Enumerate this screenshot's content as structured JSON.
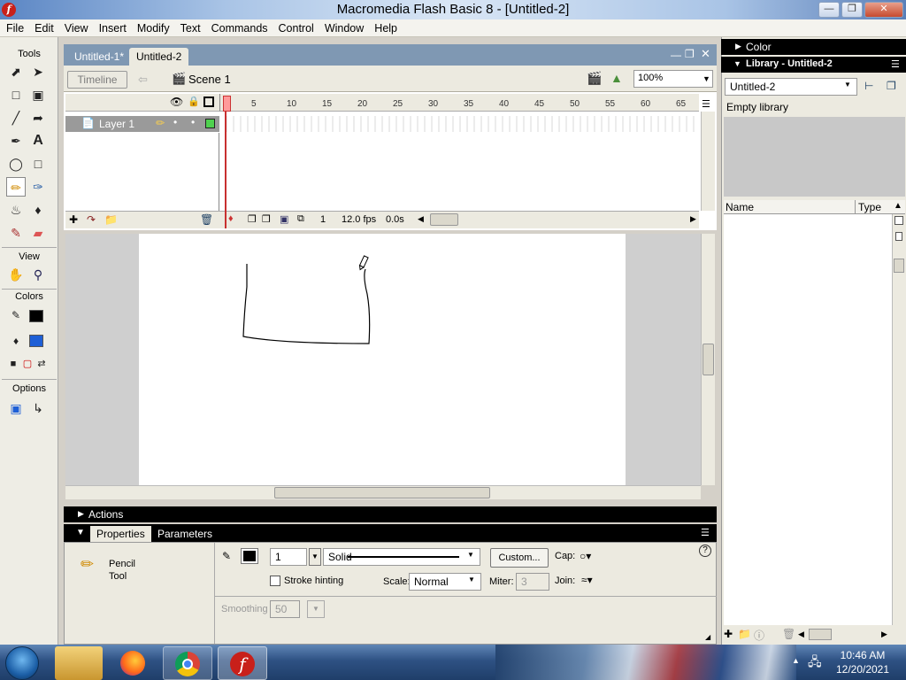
{
  "window": {
    "title": "Macromedia Flash Basic 8 - [Untitled-2]",
    "icon": "flash-icon"
  },
  "menu": [
    "File",
    "Edit",
    "View",
    "Insert",
    "Modify",
    "Text",
    "Commands",
    "Control",
    "Window",
    "Help"
  ],
  "tools": {
    "label": "Tools",
    "view_label": "View",
    "colors_label": "Colors",
    "options_label": "Options",
    "items": [
      "arrow-tool-icon",
      "subselect-tool-icon",
      "free-transform-icon",
      "fill-transform-icon",
      "line-tool-icon",
      "lasso-tool-icon",
      "pen-tool-icon",
      "text-tool-icon",
      "oval-tool-icon",
      "rectangle-tool-icon",
      "pencil-tool-icon",
      "brush-tool-icon",
      "ink-bottle-icon",
      "paint-bucket-icon",
      "eyedropper-icon",
      "eraser-icon",
      "hand-tool-icon",
      "zoom-tool-icon"
    ],
    "stroke_color": "#000000",
    "fill_color": "#1e5fd6"
  },
  "doc": {
    "tabs": [
      "Untitled-1*",
      "Untitled-2"
    ],
    "timeline_button": "Timeline",
    "scene": "Scene 1",
    "zoom": "100%"
  },
  "timeline": {
    "layer_name": "Layer 1",
    "ruler": [
      "1",
      "5",
      "10",
      "15",
      "20",
      "25",
      "30",
      "35",
      "40",
      "45",
      "50",
      "55",
      "60",
      "65"
    ],
    "current_frame": "1",
    "fps": "12.0 fps",
    "elapsed": "0.0s"
  },
  "panels": {
    "actions": "Actions",
    "properties_tab": "Properties",
    "parameters_tab": "Parameters"
  },
  "properties": {
    "tool_name": "Pencil",
    "tool_sub": "Tool",
    "stroke_height": "1",
    "stroke_style": "Solid",
    "custom_button": "Custom...",
    "cap_label": "Cap:",
    "stroke_hinting": "Stroke hinting",
    "scale_label": "Scale:",
    "scale_value": "Normal",
    "miter_label": "Miter:",
    "miter_value": "3",
    "join_label": "Join:",
    "smoothing_label": "Smoothing",
    "smoothing_value": "50"
  },
  "right": {
    "color_panel": "Color",
    "library_panel": "Library - Untitled-2",
    "library_doc": "Untitled-2",
    "library_status": "Empty library",
    "col_name": "Name",
    "col_type": "Type"
  },
  "taskbar": {
    "time": "10:46 AM",
    "date": "12/20/2021"
  }
}
